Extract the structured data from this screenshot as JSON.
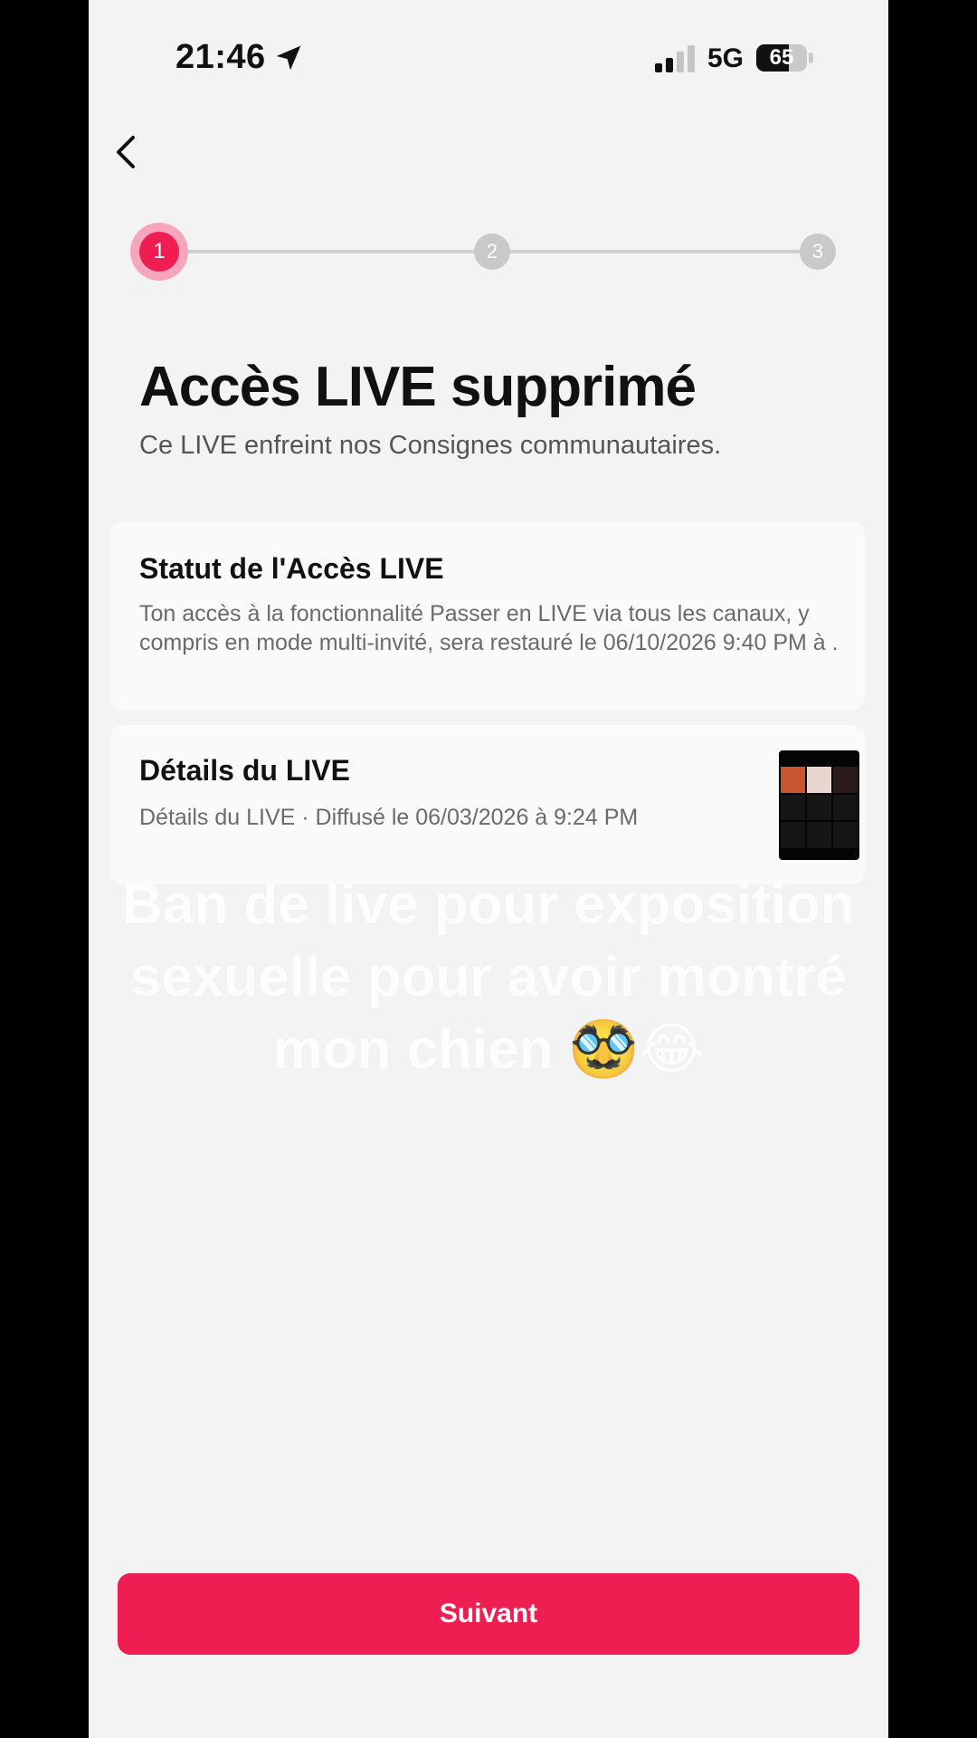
{
  "status_bar": {
    "time": "21:46",
    "network": "5G",
    "battery": "65",
    "battery_level": 0.65,
    "location_icon": "location-arrow-icon",
    "signal_icon": "cellular-signal-icon"
  },
  "nav": {
    "back_icon": "chevron-left-icon"
  },
  "stepper": {
    "steps": [
      "1",
      "2",
      "3"
    ],
    "active_step": 1
  },
  "header": {
    "title": "Accès LIVE supprimé",
    "subtitle": "Ce LIVE enfreint nos Consignes communautaires."
  },
  "status_card": {
    "title": "Statut de l'Accès LIVE",
    "text": "Ton accès à la fonctionnalité Passer en LIVE via tous les canaux, y compris en mode multi-invité, sera restauré le 06/10/2026 9:40 PM à ."
  },
  "details_card": {
    "title": "Détails du LIVE",
    "text": "Détails du LIVE · Diffusé le 06/03/2026 à 9:24 PM"
  },
  "overlay_caption": {
    "line1": "Ban de live pour exposition",
    "line2": "sexuelle pour avoir montré",
    "line3": "mon chien 🥸😂"
  },
  "footer": {
    "next_label": "Suivant"
  },
  "colors": {
    "accent": "#ee1d52",
    "accent_light": "#f6a5bd",
    "background": "#f3f3f3"
  }
}
